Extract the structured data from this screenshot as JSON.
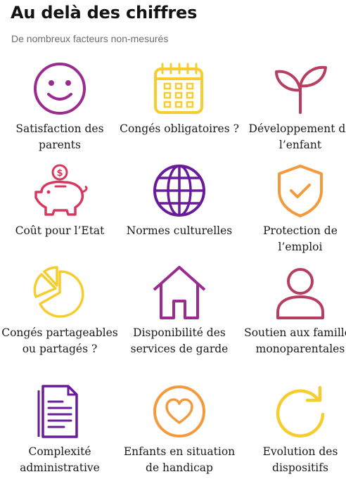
{
  "header": {
    "title": "Au delà des chiffres",
    "subtitle": "De nombreux facteurs non-mesurés"
  },
  "items": [
    {
      "label": "Satisfaction des parents",
      "icon": "smiley-face-icon",
      "color": "#9b2c8f"
    },
    {
      "label": "Congés obligatoires ?",
      "icon": "calendar-icon",
      "color": "#f5cd2f"
    },
    {
      "label": "Développement de l’enfant",
      "icon": "sprout-icon",
      "color": "#b83e5f"
    },
    {
      "label": "Coût pour l’Etat",
      "icon": "piggy-bank-icon",
      "color": "#d8385f"
    },
    {
      "label": "Normes culturelles",
      "icon": "globe-icon",
      "color": "#6a1b9a"
    },
    {
      "label": "Protection de l’emploi",
      "icon": "shield-check-icon",
      "color": "#f49a3c"
    },
    {
      "label": "Congés partageables ou partagés ?",
      "icon": "pie-chart-icon",
      "color": "#f5cd2f"
    },
    {
      "label": "Disponibilité des services de garde",
      "icon": "house-icon",
      "color": "#9b2c8f"
    },
    {
      "label": "Soutien aux familles monoparentales",
      "icon": "person-icon",
      "color": "#b83e5f"
    },
    {
      "label": "Complexité administrative",
      "icon": "document-icon",
      "color": "#6a1b9a"
    },
    {
      "label": "Enfants en situation de handicap",
      "icon": "heart-circle-icon",
      "color": "#f49a3c"
    },
    {
      "label": "Evolution des dispositifs",
      "icon": "refresh-icon",
      "color": "#f5cd2f"
    }
  ]
}
